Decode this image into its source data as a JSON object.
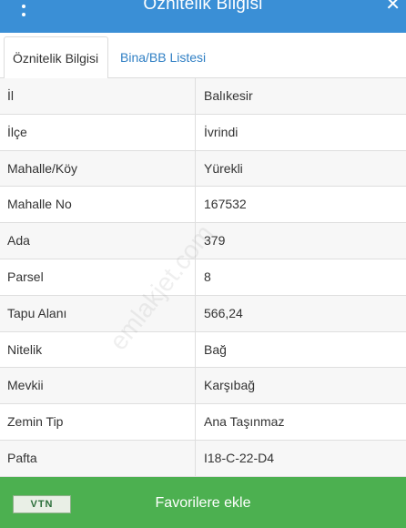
{
  "header": {
    "title": "Öznitelik Bilgisi",
    "menu_icon": "more-vertical-icon",
    "close_icon": "close-icon"
  },
  "tabs": [
    {
      "label": "Öznitelik Bilgisi",
      "active": true
    },
    {
      "label": "Bina/BB Listesi",
      "active": false
    }
  ],
  "rows": [
    {
      "key": "İl",
      "value": "Balıkesir"
    },
    {
      "key": "İlçe",
      "value": "İvrindi"
    },
    {
      "key": "Mahalle/Köy",
      "value": "Yürekli"
    },
    {
      "key": "Mahalle No",
      "value": "167532"
    },
    {
      "key": "Ada",
      "value": "379"
    },
    {
      "key": "Parsel",
      "value": "8"
    },
    {
      "key": "Tapu Alanı",
      "value": "566,24"
    },
    {
      "key": "Nitelik",
      "value": "Bağ"
    },
    {
      "key": "Mevkii",
      "value": "Karşıbağ"
    },
    {
      "key": "Zemin Tip",
      "value": "Ana Taşınmaz"
    },
    {
      "key": "Pafta",
      "value": "I18-C-22-D4"
    }
  ],
  "watermark": "emlakjet.com",
  "footer": {
    "logo_text": "VTN",
    "button_label": "Favorilere ekle"
  },
  "colors": {
    "header": "#3a8fd6",
    "tab_link": "#2f7fc4",
    "footer": "#4cb050"
  }
}
